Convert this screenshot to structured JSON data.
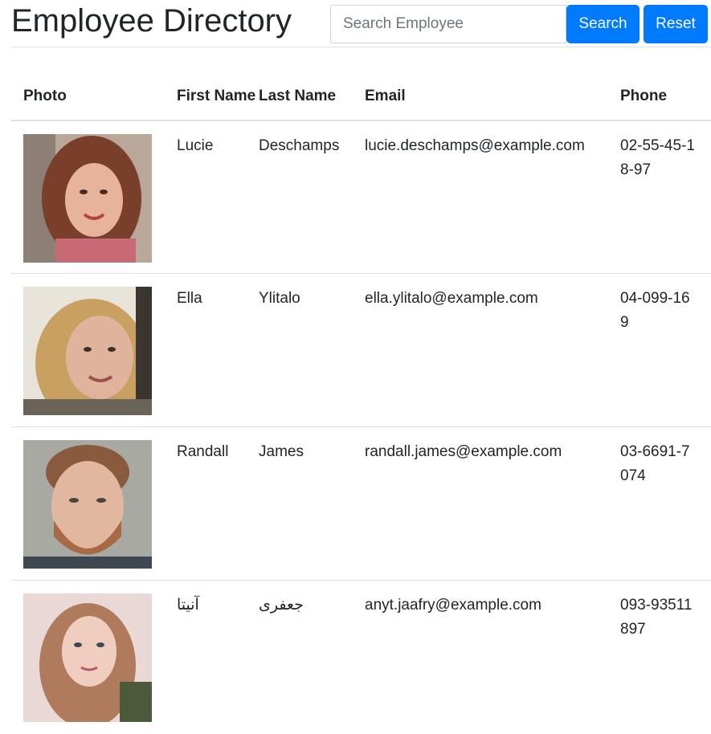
{
  "header": {
    "title": "Employee Directory",
    "search_placeholder": "Search Employee",
    "search_label": "Search",
    "reset_label": "Reset"
  },
  "table": {
    "columns": [
      "Photo",
      "First Name",
      "Last Name",
      "Email",
      "Phone"
    ],
    "rows": [
      {
        "first": "Lucie",
        "last": "Deschamps",
        "email": "lucie.deschamps@example.com",
        "phone": "02-55-45-18-97"
      },
      {
        "first": "Ella",
        "last": "Ylitalo",
        "email": "ella.ylitalo@example.com",
        "phone": "04-099-169"
      },
      {
        "first": "Randall",
        "last": "James",
        "email": "randall.james@example.com",
        "phone": "03-6691-7074"
      },
      {
        "first": "آنیتا",
        "last": "جعفری",
        "email": "anyt.jaafry@example.com",
        "phone": "093-93511897"
      }
    ]
  },
  "colors": {
    "primary": "#007bff",
    "border": "#dee2e6",
    "text": "#212529"
  }
}
